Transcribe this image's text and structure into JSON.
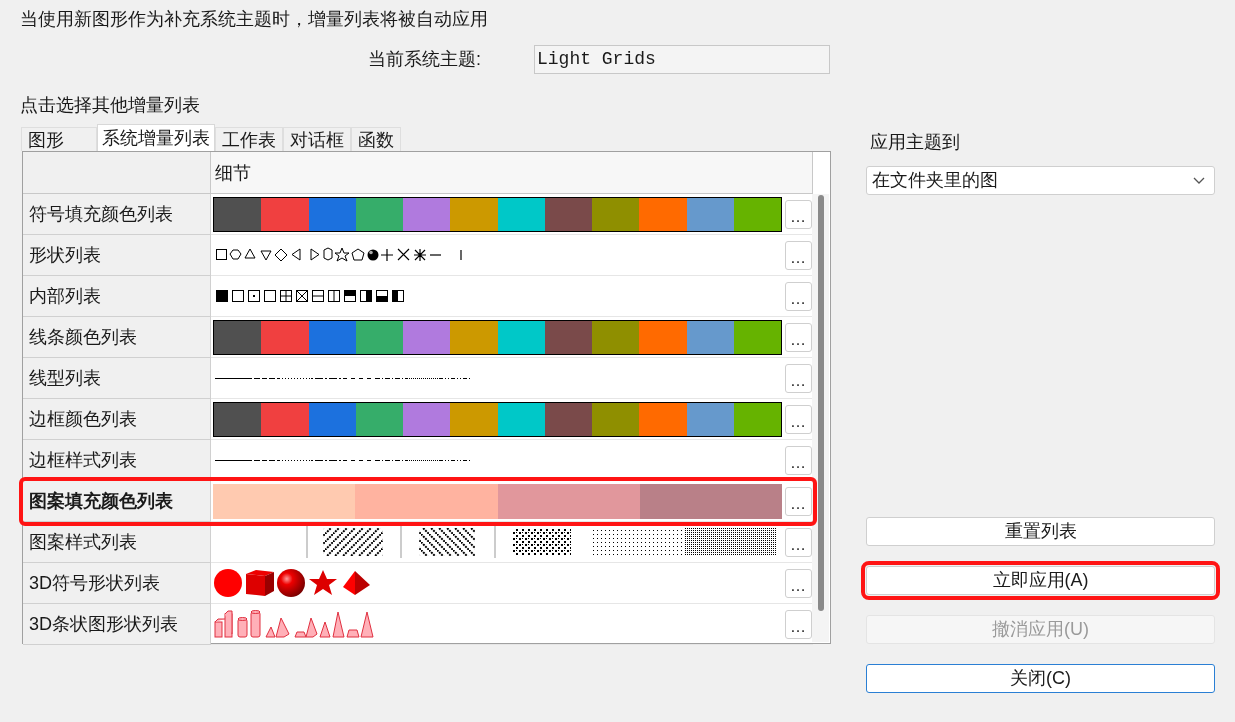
{
  "instruction": "当使用新图形作为补充系统主题时，增量列表将被自动应用",
  "current_theme": {
    "label": "当前系统主题:",
    "value": "Light Grids"
  },
  "list_prompt": "点击选择其他增量列表",
  "tabs": [
    {
      "label": "图形",
      "selected": false
    },
    {
      "label": "系统增量列表",
      "selected": true
    },
    {
      "label": "工作表",
      "selected": false
    },
    {
      "label": "对话框",
      "selected": false
    },
    {
      "label": "函数",
      "selected": false
    }
  ],
  "table": {
    "columns": [
      "细节"
    ],
    "rows": [
      {
        "label": "符号填充颜色列表",
        "kind": "colors",
        "highlighted": false,
        "button": "…",
        "swatches": [
          {
            "color": "#505050"
          },
          {
            "color": "#f04040"
          },
          {
            "color": "#1c71de"
          },
          {
            "color": "#36ad6a"
          },
          {
            "color": "#b07ade"
          },
          {
            "color": "#cc9900"
          },
          {
            "color": "#00c8c8"
          },
          {
            "color": "#7a4a4a"
          },
          {
            "color": "#8f8f00"
          },
          {
            "color": "#ff6a00"
          },
          {
            "color": "#6699cc"
          },
          {
            "color": "#66b300"
          }
        ]
      },
      {
        "label": "形状列表",
        "kind": "shapes",
        "highlighted": false,
        "button": "…"
      },
      {
        "label": "内部列表",
        "kind": "interiors",
        "highlighted": false,
        "button": "…"
      },
      {
        "label": "线条颜色列表",
        "kind": "colors",
        "highlighted": false,
        "button": "…",
        "swatches": [
          {
            "color": "#505050"
          },
          {
            "color": "#f04040"
          },
          {
            "color": "#1c71de"
          },
          {
            "color": "#36ad6a"
          },
          {
            "color": "#b07ade"
          },
          {
            "color": "#cc9900"
          },
          {
            "color": "#00c8c8"
          },
          {
            "color": "#7a4a4a"
          },
          {
            "color": "#8f8f00"
          },
          {
            "color": "#ff6a00"
          },
          {
            "color": "#6699cc"
          },
          {
            "color": "#66b300"
          }
        ]
      },
      {
        "label": "线型列表",
        "kind": "lines",
        "highlighted": false,
        "button": "…"
      },
      {
        "label": "边框颜色列表",
        "kind": "colors",
        "highlighted": false,
        "button": "…",
        "swatches": [
          {
            "color": "#505050"
          },
          {
            "color": "#f04040"
          },
          {
            "color": "#1c71de"
          },
          {
            "color": "#36ad6a"
          },
          {
            "color": "#b07ade"
          },
          {
            "color": "#cc9900"
          },
          {
            "color": "#00c8c8"
          },
          {
            "color": "#7a4a4a"
          },
          {
            "color": "#8f8f00"
          },
          {
            "color": "#ff6a00"
          },
          {
            "color": "#6699cc"
          },
          {
            "color": "#66b300"
          }
        ]
      },
      {
        "label": "边框样式列表",
        "kind": "lines",
        "highlighted": false,
        "button": "…"
      },
      {
        "label": "图案填充颜色列表",
        "kind": "colors",
        "highlighted": true,
        "button": "…",
        "swatches": [
          {
            "color": "#ffcab0"
          },
          {
            "color": "#ffb3a0"
          },
          {
            "color": "#e1979c"
          },
          {
            "color": "#b98088"
          }
        ]
      },
      {
        "label": "图案样式列表",
        "kind": "patterns",
        "highlighted": false,
        "button": "…"
      },
      {
        "label": "3D符号形状列表",
        "kind": "symbols3d",
        "highlighted": false,
        "button": "…"
      },
      {
        "label": "3D条状图形状列表",
        "kind": "bars3d",
        "highlighted": false,
        "button": "…"
      }
    ]
  },
  "apply_to": {
    "label": "应用主题到",
    "value": "在文件夹里的图"
  },
  "buttons": [
    {
      "label": "重置列表",
      "highlighted": false,
      "disabled": false
    },
    {
      "label": "立即应用(A)",
      "highlighted": true,
      "disabled": false
    },
    {
      "label": "撤消应用(U)",
      "highlighted": false,
      "disabled": true
    },
    {
      "label": "关闭(C)",
      "highlighted": false,
      "disabled": false,
      "focused": true
    }
  ]
}
